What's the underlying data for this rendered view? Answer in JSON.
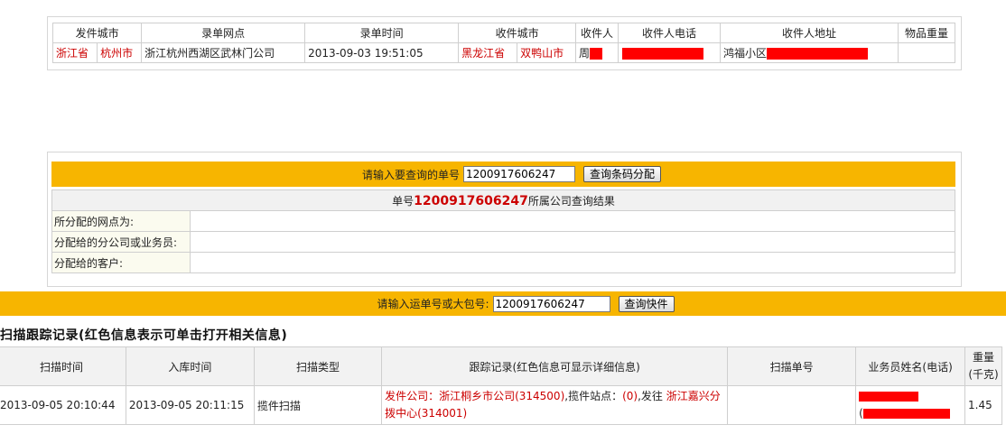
{
  "shipment": {
    "headers": [
      "发件城市",
      "录单网点",
      "录单时间",
      "收件城市",
      "收件人",
      "收件人电话",
      "收件人地址",
      "物品重量"
    ],
    "send_province": "浙江省",
    "send_city": "杭州市",
    "entry_outlet": "浙江杭州西湖区武林门公司",
    "entry_time": "2013-09-03 19:51:05",
    "recv_province": "黑龙江省",
    "recv_city": "双鸭山市",
    "recipient_prefix": "周",
    "address_prefix": "鸿福小区",
    "weight": ""
  },
  "barcode_query": {
    "prompt": "请输入要查询的单号",
    "input_value": "1200917606247",
    "button": "查询条码分配",
    "result_prefix": "单号",
    "result_number": "1200917606247",
    "result_suffix": "所属公司查询结果",
    "rows": [
      {
        "label": "所分配的网点为:",
        "value": ""
      },
      {
        "label": "分配给的分公司或业务员:",
        "value": ""
      },
      {
        "label": "分配给的客户:",
        "value": ""
      }
    ]
  },
  "waybill_query": {
    "prompt": "请输入运单号或大包号:",
    "input_value": "1200917606247",
    "button": "查询快件"
  },
  "scan_records": {
    "title": "扫描跟踪记录(红色信息表示可单击打开相关信息)",
    "headers": {
      "scan_time": "扫描时间",
      "storage_time": "入库时间",
      "scan_type": "扫描类型",
      "tracking": "跟踪记录(红色信息可显示详细信息)",
      "scan_no": "扫描单号",
      "staff": "业务员姓名(电话)",
      "weight_1": "重量",
      "weight_2": "(千克)"
    },
    "rows": [
      {
        "scan_time": "2013-09-05 20:10:44",
        "storage_time": "2013-09-05 20:11:15",
        "scan_type": "揽件扫描",
        "tracking_prefix": "发件公司：",
        "tracking_company": "浙江桐乡市公司(314500)",
        "tracking_mid1": ",揽件站点：",
        "tracking_site": "(0)",
        "tracking_mid2": ",发往 ",
        "tracking_dest_1": "浙江嘉兴分",
        "tracking_dest_2": "拨中心(314001)",
        "scan_no": "",
        "staff_paren": "(",
        "weight": "1.45"
      }
    ]
  },
  "colors": {
    "accent_yellow": "#f7b500",
    "link_red": "#cc0000",
    "redaction": "#ff0000"
  }
}
